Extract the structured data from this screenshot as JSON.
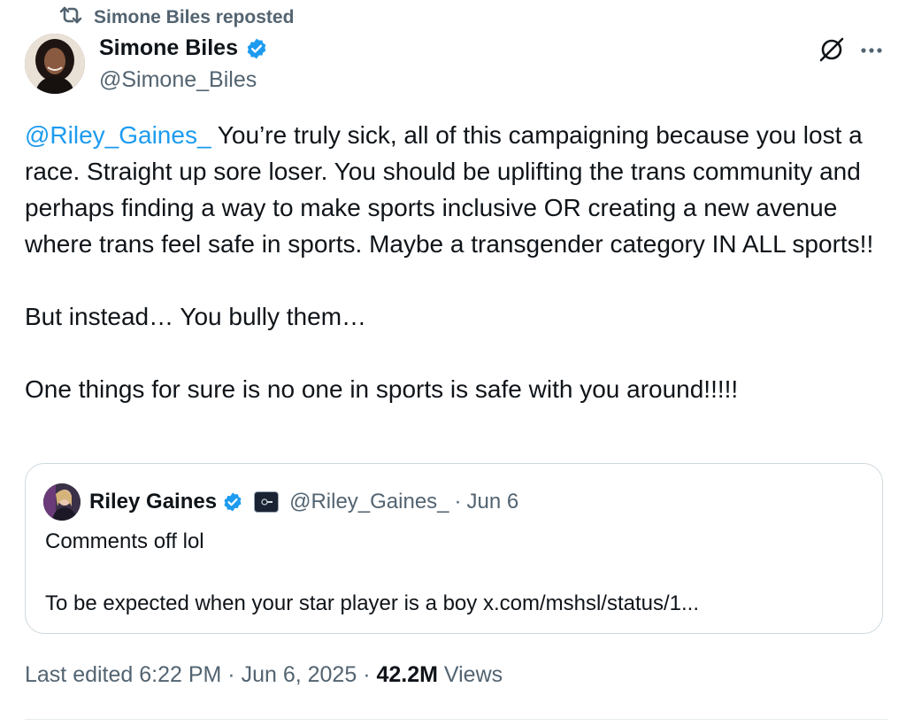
{
  "repost_bar": {
    "icon": "repost-icon",
    "text": "Simone Biles reposted"
  },
  "author": {
    "name": "Simone Biles",
    "handle": "@Simone_Biles",
    "verified": true,
    "avatar": "avatar"
  },
  "tweet": {
    "mention": "@Riley_Gaines_",
    "line1_rest": " You’re truly sick, all of this campaigning because you lost a race. Straight up sore loser. You should be uplifting the trans community and perhaps finding a way to make sports inclusive OR creating a new avenue where trans feel safe in sports. Maybe a transgender category IN ALL sports!!",
    "paragraph2": "But instead… You bully them…",
    "paragraph3": "One things for sure is no one in sports is safe with you around!!!!!"
  },
  "quote": {
    "name": "Riley Gaines",
    "verified": true,
    "handle": "@Riley_Gaines_",
    "separator": "·",
    "date": "Jun 6",
    "text1": "Comments off lol",
    "text2": "To be expected when your star player is a boy x.com/mshsl/status/1..."
  },
  "meta": {
    "edited_label": "Last edited 6:22 PM · Jun 6, 2025 · ",
    "views_count": "42.2M",
    "views_label": " Views"
  },
  "colors": {
    "accent": "#1d9bf0",
    "text": "#0f1419",
    "secondary": "#536471",
    "border": "#cfd9de"
  }
}
